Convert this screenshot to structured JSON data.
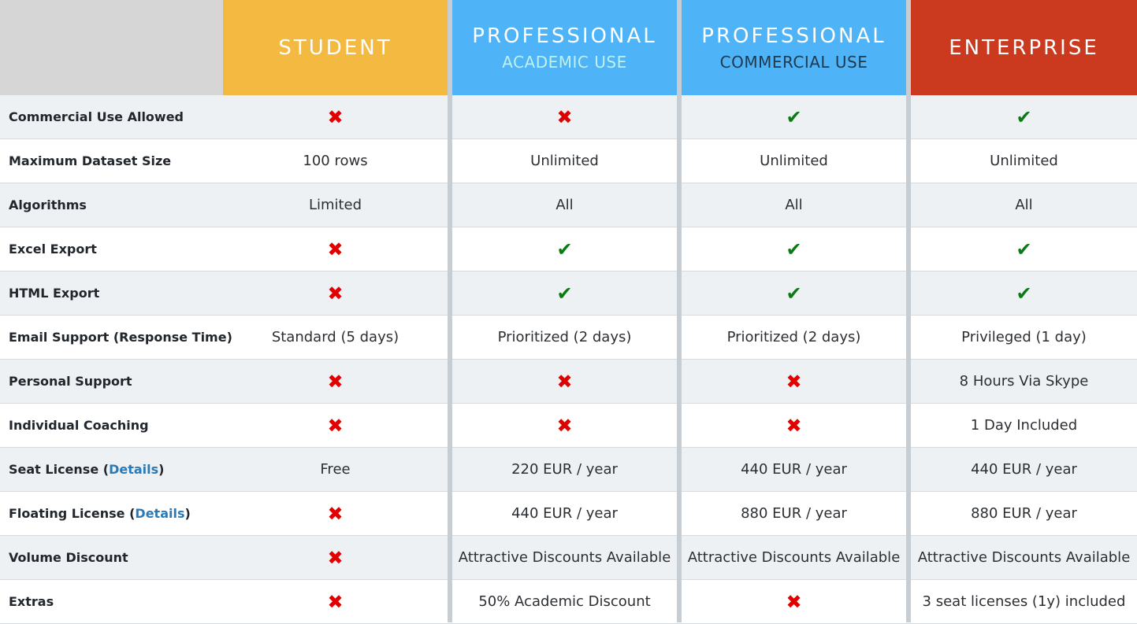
{
  "colors": {
    "student": "#f3b940",
    "professional": "#4eb3f7",
    "enterprise": "#cb3a1f",
    "empty_header": "#d6d6d6",
    "academic_sub": "#bff0ee",
    "commercial_sub": "#1f3a4d",
    "cross": "#e00000",
    "check": "#0a7a12",
    "link": "#2a7ab8"
  },
  "plans": [
    {
      "title": "STUDENT",
      "subtitle": ""
    },
    {
      "title": "PROFESSIONAL",
      "subtitle": "ACADEMIC USE"
    },
    {
      "title": "PROFESSIONAL",
      "subtitle": "COMMERCIAL USE"
    },
    {
      "title": "ENTERPRISE",
      "subtitle": ""
    }
  ],
  "rows": [
    {
      "label": "Commercial Use Allowed",
      "values": [
        "✖",
        "✖",
        "✔",
        "✔"
      ]
    },
    {
      "label": "Maximum Dataset Size",
      "values": [
        "100 rows",
        "Unlimited",
        "Unlimited",
        "Unlimited"
      ]
    },
    {
      "label": "Algorithms",
      "values": [
        "Limited",
        "All",
        "All",
        "All"
      ]
    },
    {
      "label": "Excel Export",
      "values": [
        "✖",
        "✔",
        "✔",
        "✔"
      ]
    },
    {
      "label": "HTML Export",
      "values": [
        "✖",
        "✔",
        "✔",
        "✔"
      ]
    },
    {
      "label": "Email Support (Response Time)",
      "values": [
        "Standard (5 days)",
        "Prioritized (2 days)",
        "Prioritized (2 days)",
        "Privileged (1 day)"
      ]
    },
    {
      "label": "Personal Support",
      "values": [
        "✖",
        "✖",
        "✖",
        "8 Hours Via Skype"
      ]
    },
    {
      "label": "Individual Coaching",
      "values": [
        "✖",
        "✖",
        "✖",
        "1 Day Included"
      ]
    },
    {
      "label": "Seat License (",
      "link": "Details",
      "label_end": ")",
      "values": [
        "Free",
        "220 EUR / year",
        "440 EUR / year",
        "440 EUR / year"
      ]
    },
    {
      "label": "Floating License (",
      "link": "Details",
      "label_end": ")",
      "values": [
        "✖",
        "440 EUR / year",
        "880 EUR / year",
        "880 EUR / year"
      ]
    },
    {
      "label": "Volume Discount",
      "values": [
        "✖",
        "Attractive Discounts Available",
        "Attractive Discounts Available",
        "Attractive Discounts Available"
      ]
    },
    {
      "label": "Extras",
      "values": [
        "✖",
        "50% Academic Discount",
        "✖",
        "3 seat licenses (1y) included"
      ]
    }
  ]
}
